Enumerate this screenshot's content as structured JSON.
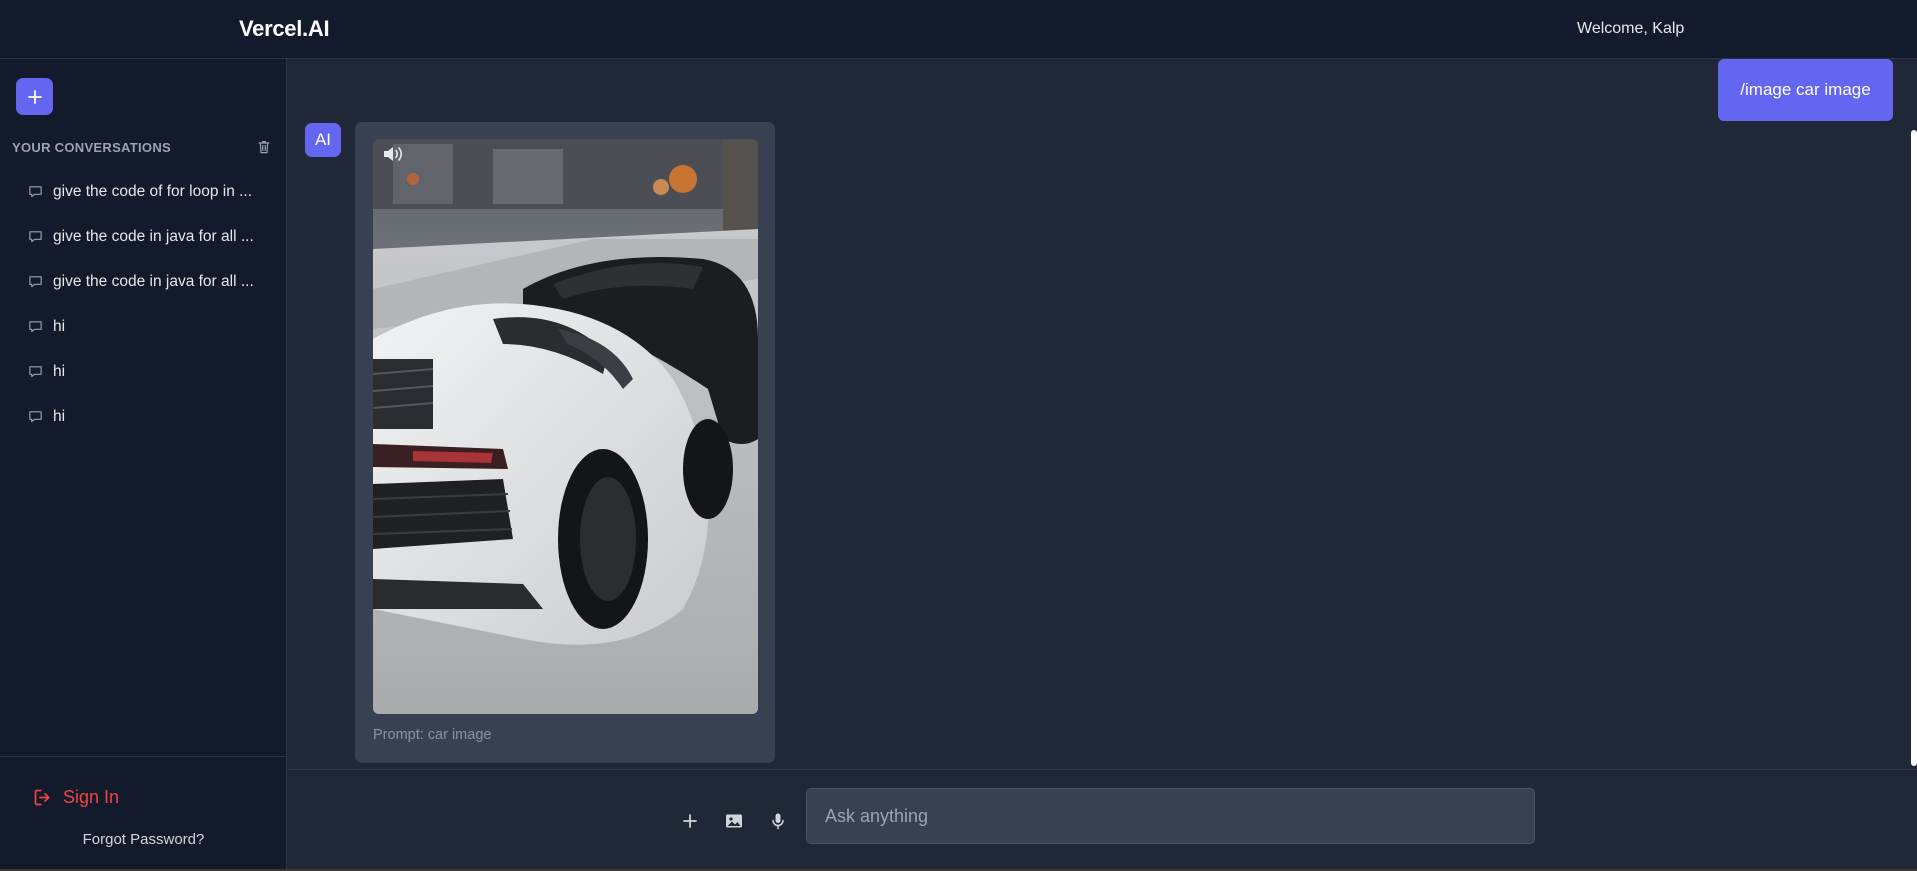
{
  "header": {
    "brand": "Vercel.AI",
    "welcome": "Welcome, Kalp"
  },
  "sidebar": {
    "new_chat_icon": "plus-icon",
    "section_title": "YOUR CONVERSATIONS",
    "delete_icon": "trash-icon",
    "conversations": [
      {
        "label": "give the code of for loop in ..."
      },
      {
        "label": "give the code in java for all ..."
      },
      {
        "label": "give the code in java for all ..."
      },
      {
        "label": "hi"
      },
      {
        "label": "hi"
      },
      {
        "label": "hi"
      }
    ],
    "sign_in": "Sign In",
    "forgot_password": "Forgot Password?"
  },
  "chat": {
    "user_message": "/image car image",
    "ai_avatar": "AI",
    "prompt_caption": "Prompt: car image"
  },
  "composer": {
    "placeholder": "Ask anything",
    "icons": [
      "plus-icon",
      "image-icon",
      "microphone-icon"
    ]
  },
  "colors": {
    "accent": "#6366f1",
    "background": "#202838",
    "sidebar": "#131a2b",
    "danger": "#ef4444"
  }
}
